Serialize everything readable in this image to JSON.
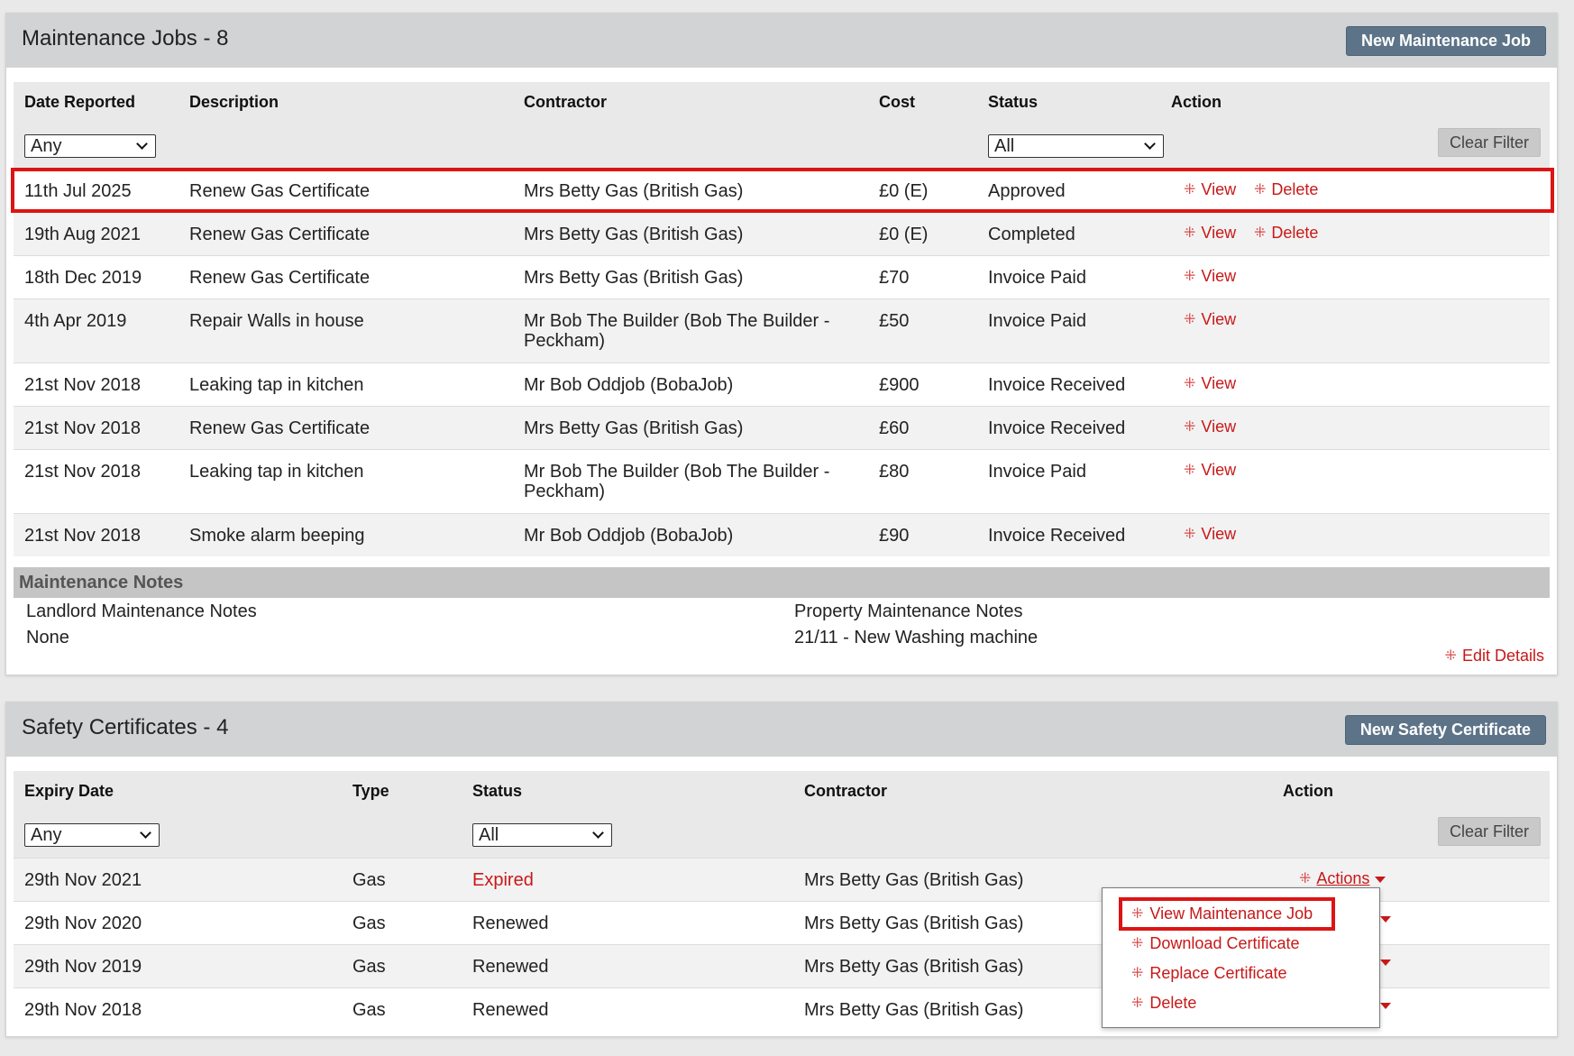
{
  "maintenance": {
    "title": "Maintenance Jobs - 8",
    "new_button": "New Maintenance Job",
    "columns": [
      "Date Reported",
      "Description",
      "Contractor",
      "Cost",
      "Status",
      "Action"
    ],
    "filters": {
      "date": "Any",
      "status": "All",
      "clear": "Clear Filter"
    },
    "rows": [
      {
        "date": "11th Jul 2025",
        "description": "Renew Gas Certificate",
        "contractor": "Mrs Betty Gas (British Gas)",
        "contractor2": "",
        "cost": "£0 (E)",
        "status": "Approved",
        "view": "View",
        "delete": "Delete"
      },
      {
        "date": "19th Aug 2021",
        "description": "Renew Gas Certificate",
        "contractor": "Mrs Betty Gas (British Gas)",
        "contractor2": "",
        "cost": "£0 (E)",
        "status": "Completed",
        "view": "View",
        "delete": "Delete"
      },
      {
        "date": "18th Dec 2019",
        "description": "Renew Gas Certificate",
        "contractor": "Mrs Betty Gas (British Gas)",
        "contractor2": "",
        "cost": "£70",
        "status": "Invoice Paid",
        "view": "View"
      },
      {
        "date": "4th Apr 2019",
        "description": "Repair Walls in house",
        "contractor": "Mr Bob The Builder (Bob The Builder -",
        "contractor2": "Peckham)",
        "cost": "£50",
        "status": "Invoice Paid",
        "view": "View"
      },
      {
        "date": "21st Nov 2018",
        "description": "Leaking tap in kitchen",
        "contractor": "Mr Bob Oddjob (BobaJob)",
        "contractor2": "",
        "cost": "£900",
        "status": "Invoice Received",
        "view": "View"
      },
      {
        "date": "21st Nov 2018",
        "description": "Renew Gas Certificate",
        "contractor": "Mrs Betty Gas (British Gas)",
        "contractor2": "",
        "cost": "£60",
        "status": "Invoice Received",
        "view": "View"
      },
      {
        "date": "21st Nov 2018",
        "description": "Leaking tap in kitchen",
        "contractor": "Mr Bob The Builder (Bob The Builder -",
        "contractor2": "Peckham)",
        "cost": "£80",
        "status": "Invoice Paid",
        "view": "View"
      },
      {
        "date": "21st Nov 2018",
        "description": "Smoke alarm beeping",
        "contractor": "Mr Bob Oddjob (BobaJob)",
        "contractor2": "",
        "cost": "£90",
        "status": "Invoice Received",
        "view": "View"
      }
    ],
    "notes": {
      "title": "Maintenance Notes",
      "landlord_label": "Landlord Maintenance Notes",
      "landlord_value": "None",
      "property_label": "Property Maintenance Notes",
      "property_value": "21/11 - New Washing machine",
      "edit": "Edit Details"
    }
  },
  "certificates": {
    "title": "Safety Certificates - 4",
    "new_button": "New Safety Certificate",
    "columns": [
      "Expiry Date",
      "Type",
      "Status",
      "Contractor",
      "Action"
    ],
    "filters": {
      "expiry": "Any",
      "status": "All",
      "clear": "Clear Filter"
    },
    "rows": [
      {
        "expiry": "29th Nov 2021",
        "type": "Gas",
        "status": "Expired",
        "contractor": "Mrs Betty Gas (British Gas)"
      },
      {
        "expiry": "29th Nov 2020",
        "type": "Gas",
        "status": "Renewed",
        "contractor": "Mrs Betty Gas (British Gas)"
      },
      {
        "expiry": "29th Nov 2019",
        "type": "Gas",
        "status": "Renewed",
        "contractor": "Mrs Betty Gas (British Gas)"
      },
      {
        "expiry": "29th Nov 2018",
        "type": "Gas",
        "status": "Renewed",
        "contractor": "Mrs Betty Gas (British Gas)"
      }
    ],
    "actions_label": "Actions",
    "dropdown": [
      "View Maintenance Job",
      "Download Certificate",
      "Replace Certificate",
      "Delete"
    ]
  },
  "colors": {
    "accent_red": "#c81818",
    "button_blue": "#5d7488",
    "highlight": "#dc1414",
    "expired": "#c81818"
  },
  "icons": {
    "action": "move-icon"
  }
}
